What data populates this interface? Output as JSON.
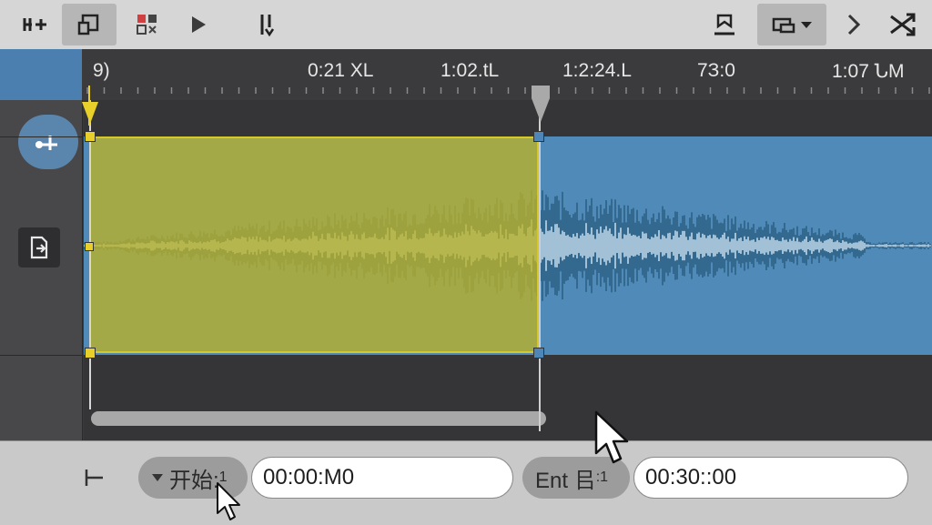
{
  "toolbar": {
    "left_icons": [
      "add-track-icon",
      "marquee-select-icon",
      "grid-icon",
      "play-icon",
      "split-icon"
    ],
    "right_icons": [
      "export-icon",
      "display-dropdown-icon",
      "chevron-right-icon",
      "shuffle-icon"
    ]
  },
  "ruler": {
    "labels": [
      "9)",
      "0:21 XL",
      "1:02.tL",
      "1:2:24.L",
      "7З:0",
      "1:07 ՆM"
    ]
  },
  "selection": {
    "start_label": "开始:",
    "start_suffix": "1",
    "start_value": "00:00:M0",
    "end_label": "Ent 㠯",
    "end_suffix": ":1",
    "end_value": "00:30::00"
  },
  "colors": {
    "selection_fill": "#a39f45",
    "selection_border": "#d4c82a",
    "clip_fill": "#4f8ab8",
    "waveform_dark": "#2c5f85",
    "waveform_light": "#bcd4e6",
    "handle_yellow": "#e8cf2a",
    "handle_blue": "#4f86b8"
  }
}
